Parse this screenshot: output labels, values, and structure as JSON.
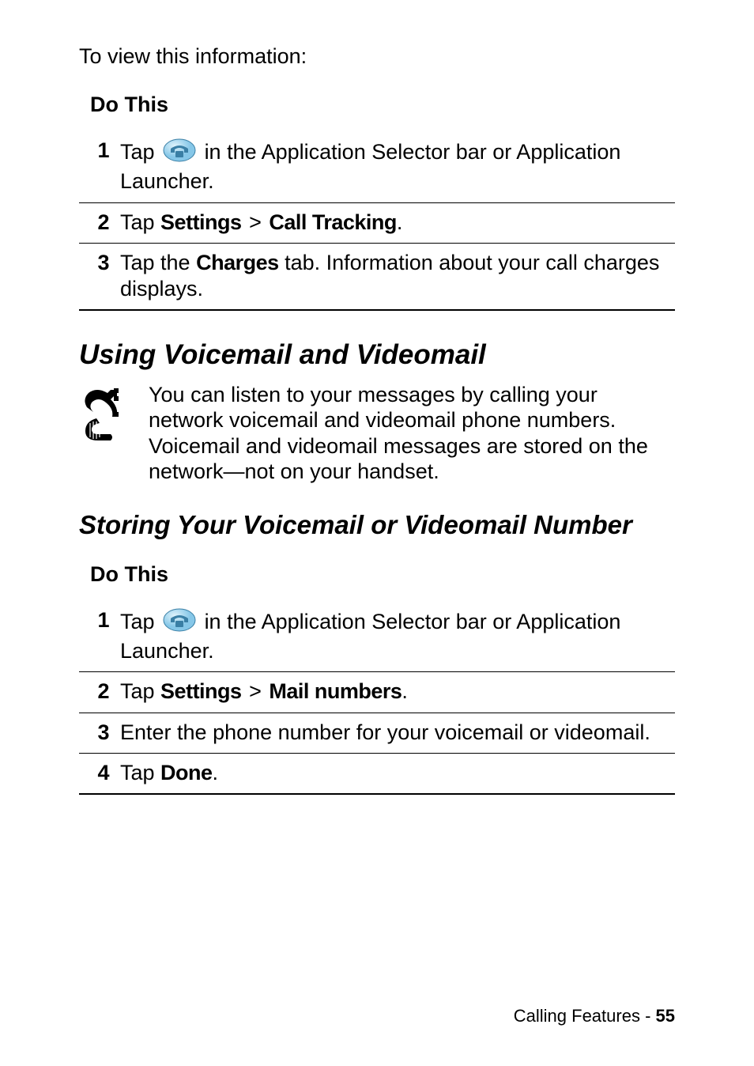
{
  "intro": "To view this information:",
  "table1": {
    "header": "Do This",
    "rows": [
      {
        "num": "1",
        "pre": "Tap ",
        "post": "  in the Application Selector bar or Application Launcher.",
        "has_icon": true
      },
      {
        "num": "2",
        "tap": "Tap ",
        "b1": "Settings",
        "sep": " > ",
        "b2": "Call Tracking",
        "end": "."
      },
      {
        "num": "3",
        "tap": "Tap the ",
        "b1": "Charges",
        "post": " tab. Information about your call charges displays."
      }
    ]
  },
  "section1": {
    "title": "Using Voicemail and Videomail",
    "body": "You can listen to your messages by calling your network voicemail and videomail phone numbers. Voicemail and videomail messages are stored on the network—not on your handset."
  },
  "section2": {
    "title": "Storing Your Voicemail or Videomail Number"
  },
  "table2": {
    "header": "Do This",
    "rows": [
      {
        "num": "1",
        "pre": "Tap ",
        "post": "  in the Application Selector bar or Application Launcher.",
        "has_icon": true
      },
      {
        "num": "2",
        "tap": "Tap ",
        "b1": "Settings",
        "sep": " > ",
        "b2": "Mail numbers",
        "end": "."
      },
      {
        "num": "3",
        "text": "Enter the phone number for your voicemail or videomail."
      },
      {
        "num": "4",
        "tap": "Tap ",
        "b1": "Done",
        "end": "."
      }
    ]
  },
  "footer": {
    "section": "Calling Features - ",
    "page": "55"
  }
}
